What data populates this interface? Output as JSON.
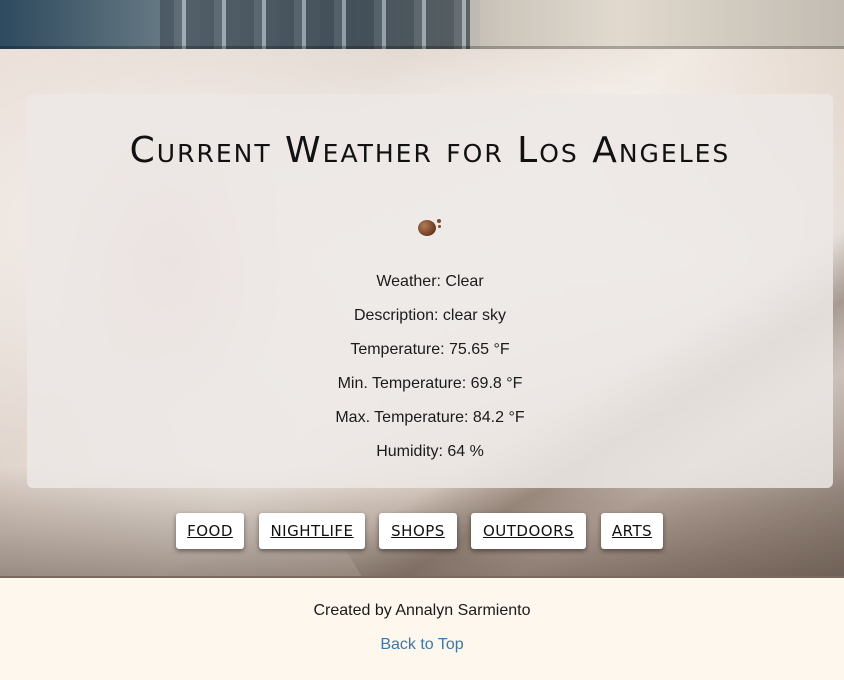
{
  "page": {
    "title": "Current Weather for Los Angeles",
    "weather_icon": "weather-icon"
  },
  "weather": {
    "main": "Weather: Clear",
    "description": "Description: clear sky",
    "temp": "Temperature: 75.65 °F",
    "temp_min": "Min. Temperature: 69.8 °F",
    "temp_max": "Max. Temperature: 84.2 °F",
    "humidity": "Humidity: 64 %"
  },
  "nav": {
    "items": [
      {
        "label": "FOOD"
      },
      {
        "label": "NIGHTLIFE"
      },
      {
        "label": "SHOPS"
      },
      {
        "label": "OUTDOORS"
      },
      {
        "label": "ARTS"
      }
    ]
  },
  "footer": {
    "credit": "Created by Annalyn Sarmiento",
    "back_to_top": "Back to Top"
  },
  "colors": {
    "link": "#3f77a8",
    "card": "#ece8e5",
    "footer_bg": "#fdf7ee"
  }
}
